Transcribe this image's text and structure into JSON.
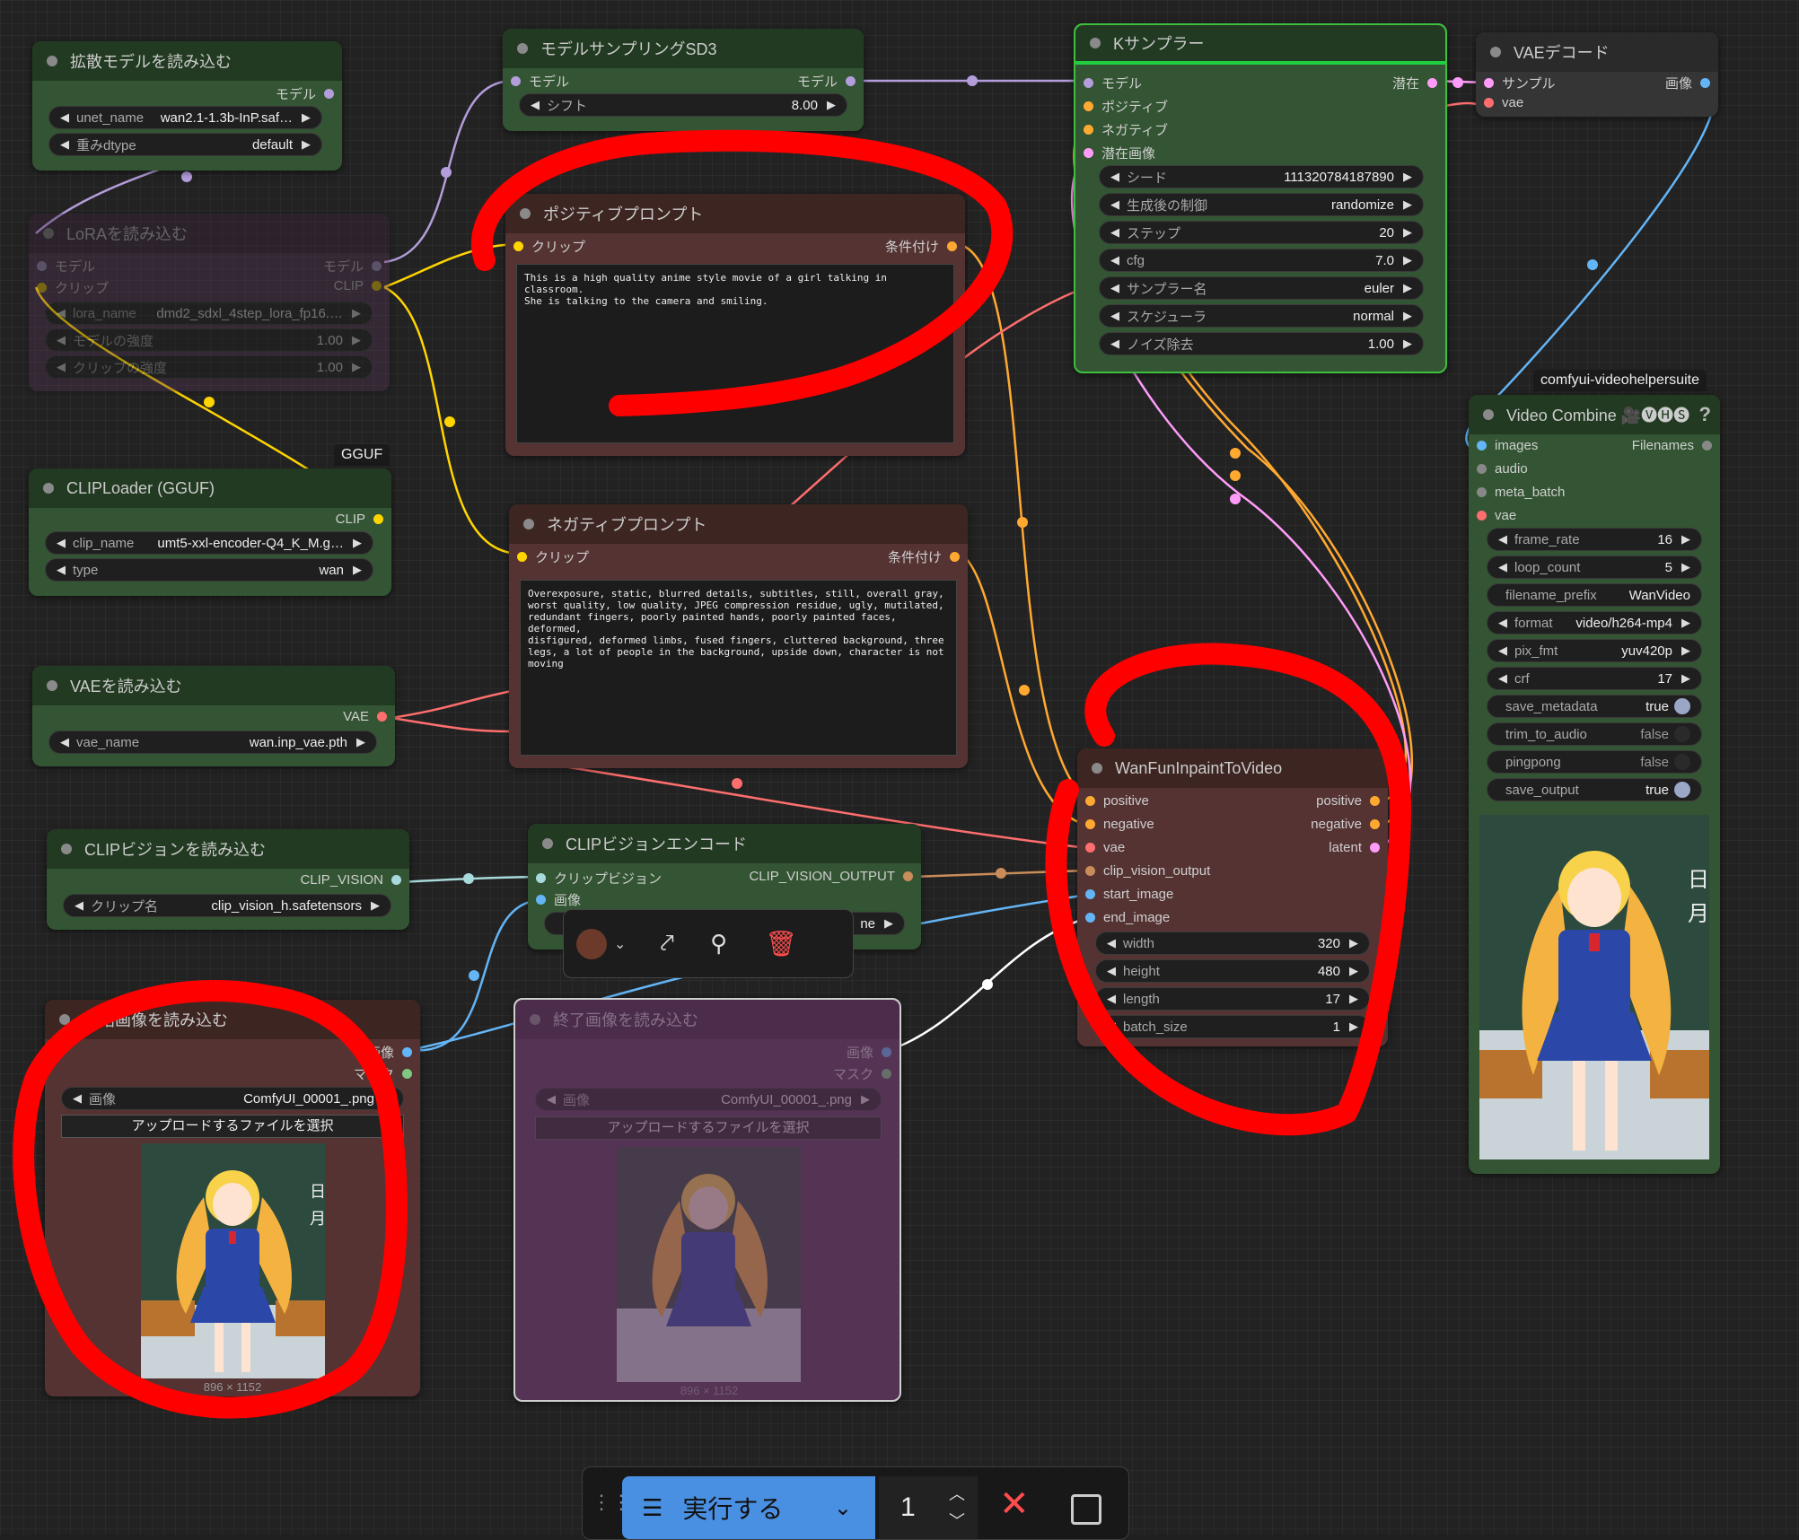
{
  "colors": {
    "model_link": "#b39ddb",
    "clip_link": "#ffd500",
    "cond_link": "#ffa931",
    "vae_link": "#ff6e6e",
    "latent_link": "#ff9cf9",
    "image_link": "#64b5f6",
    "clip_vision_link": "#a8dadc",
    "red_scribble": "#ff0000",
    "run_button": "#4a90e2"
  },
  "nodes": {
    "load_diffusion": {
      "title": "拡散モデルを読み込む",
      "out_model": "モデル",
      "w1_label": "unet_name",
      "w1_value": "wan2.1-1.3b-InP.saf…",
      "w2_label": "重みdtype",
      "w2_value": "default"
    },
    "lora": {
      "title": "LoRAを読み込む",
      "in_model": "モデル",
      "in_clip": "クリップ",
      "out_model": "モデル",
      "out_clip": "CLIP",
      "w1_label": "lora_name",
      "w1_value": "dmd2_sdxl_4step_lora_fp16.…",
      "w2_label": "モデルの強度",
      "w2_value": "1.00",
      "w3_label": "クリップの強度",
      "w3_value": "1.00"
    },
    "cliploader": {
      "badge": "GGUF",
      "title": "CLIPLoader (GGUF)",
      "out_clip": "CLIP",
      "w1_label": "clip_name",
      "w1_value": "umt5-xxl-encoder-Q4_K_M.g…",
      "w2_label": "type",
      "w2_value": "wan"
    },
    "vae_loader": {
      "title": "VAEを読み込む",
      "out_vae": "VAE",
      "w1_label": "vae_name",
      "w1_value": "wan.inp_vae.pth"
    },
    "clipvision_loader": {
      "title": "CLIPビジョンを読み込む",
      "out": "CLIP_VISION",
      "w1_label": "クリップ名",
      "w1_value": "clip_vision_h.safetensors"
    },
    "start_image": {
      "title": "開始画像を読み込む",
      "out_image": "画像",
      "out_mask": "マスク",
      "w1_label": "画像",
      "w1_value": "ComfyUI_00001_.png",
      "upload": "アップロードするファイルを選択",
      "caption": "896 × 1152"
    },
    "end_image": {
      "title": "終了画像を読み込む",
      "out_image": "画像",
      "out_mask": "マスク",
      "w1_label": "画像",
      "w1_value": "ComfyUI_00001_.png",
      "upload": "アップロードするファイルを選択",
      "caption": "896 × 1152"
    },
    "model_sampling": {
      "title": "モデルサンプリングSD3",
      "in_model": "モデル",
      "out_model": "モデル",
      "w1_label": "シフト",
      "w1_value": "8.00"
    },
    "positive_prompt": {
      "title": "ポジティブプロンプト",
      "in_clip": "クリップ",
      "out": "条件付け",
      "text": "This is a high quality anime style movie of a girl talking in classroom.\nShe is talking to the camera and smiling."
    },
    "negative_prompt": {
      "title": "ネガティブプロンプト",
      "in_clip": "クリップ",
      "out": "条件付け",
      "text": "Overexposure, static, blurred details, subtitles, still, overall gray,\nworst quality, low quality, JPEG compression residue, ugly, mutilated,\nredundant fingers, poorly painted hands, poorly painted faces, deformed,\ndisfigured, deformed limbs, fused fingers, cluttered background, three\nlegs, a lot of people in the background, upside down, character is not\nmoving"
    },
    "clipvision_encode": {
      "title": "CLIPビジョンエンコード",
      "in1": "クリップビジョン",
      "in2": "画像",
      "out": "CLIP_VISION_OUTPUT",
      "w1_tail": "ne"
    },
    "ksampler": {
      "title": "Kサンプラー",
      "in_model": "モデル",
      "in_pos": "ポジティブ",
      "in_neg": "ネガティブ",
      "in_latent": "潜在画像",
      "out": "潜在",
      "widgets": [
        {
          "label": "シード",
          "value": "111320784187890"
        },
        {
          "label": "生成後の制御",
          "value": "randomize"
        },
        {
          "label": "ステップ",
          "value": "20"
        },
        {
          "label": "cfg",
          "value": "7.0"
        },
        {
          "label": "サンプラー名",
          "value": "euler"
        },
        {
          "label": "スケジューラ",
          "value": "normal"
        },
        {
          "label": "ノイズ除去",
          "value": "1.00"
        }
      ]
    },
    "vae_decode": {
      "title": "VAEデコード",
      "in1": "サンプル",
      "in2": "vae",
      "out": "画像"
    },
    "wanfun": {
      "title": "WanFunInpaintToVideo",
      "inputs": [
        "positive",
        "negative",
        "vae",
        "clip_vision_output",
        "start_image",
        "end_image"
      ],
      "outputs": [
        "positive",
        "negative",
        "latent"
      ],
      "widgets": [
        {
          "label": "width",
          "value": "320"
        },
        {
          "label": "height",
          "value": "480"
        },
        {
          "label": "length",
          "value": "17"
        },
        {
          "label": "batch_size",
          "value": "1"
        }
      ]
    },
    "video_combine": {
      "badge": "comfyui-videohelpersuite",
      "title": "Video Combine 🎥🅥🅗🅢",
      "help": "?",
      "inputs": [
        "images",
        "audio",
        "meta_batch",
        "vae"
      ],
      "out": "Filenames",
      "widgets": [
        {
          "label": "frame_rate",
          "value": "16"
        },
        {
          "label": "loop_count",
          "value": "5"
        },
        {
          "label": "filename_prefix",
          "value": "WanVideo"
        },
        {
          "label": "format",
          "value": "video/h264-mp4"
        },
        {
          "label": "pix_fmt",
          "value": "yuv420p"
        },
        {
          "label": "crf",
          "value": "17"
        }
      ],
      "toggles": [
        {
          "label": "save_metadata",
          "value": "true"
        },
        {
          "label": "trim_to_audio",
          "value": "false"
        },
        {
          "label": "pingpong",
          "value": "false"
        },
        {
          "label": "save_output",
          "value": "true"
        }
      ]
    }
  },
  "toolbox": {
    "color_icon": "color-circle-icon",
    "bypass_icon": "bypass-wand-icon",
    "pin_icon": "pin-icon",
    "delete_icon": "trash-icon"
  },
  "runbar": {
    "grip_icon": "drag-grip-icon",
    "run_label": "実行する",
    "queue_count": "1"
  }
}
